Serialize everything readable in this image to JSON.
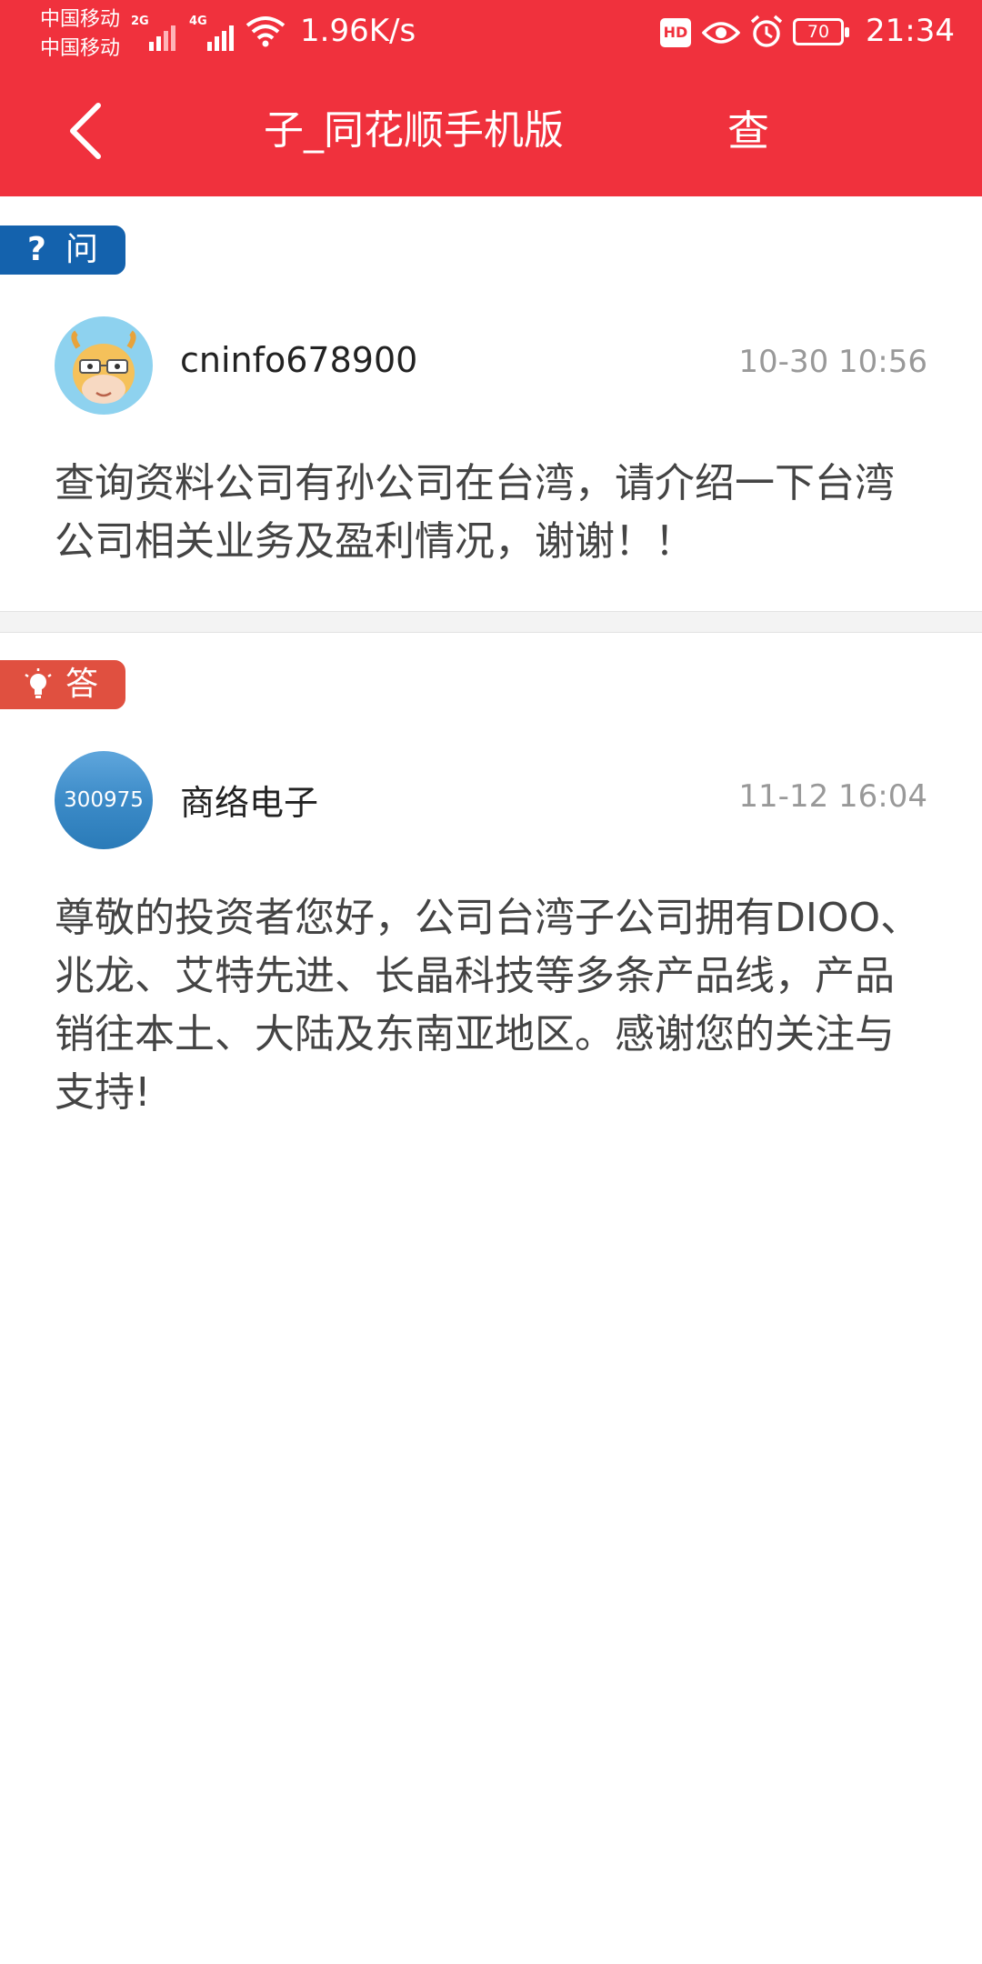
{
  "status_bar": {
    "carrier_1": "中国移动",
    "carrier_2": "中国移动",
    "signal_1_tag": "2G",
    "signal_2_tag": "4G",
    "net_speed": "1.96K/s",
    "hd_badge": "HD",
    "battery": "70",
    "time": "21:34"
  },
  "nav": {
    "title": "子_同花顺手机版",
    "action_label": "查"
  },
  "question": {
    "badge_glyph": "?",
    "badge_label": "问",
    "user": "cninfo678900",
    "time": "10-30 10:56",
    "text": "查询资料公司有孙公司在台湾，请介绍一下台湾公司相关业务及盈利情况，谢谢！！"
  },
  "answer": {
    "badge_label": "答",
    "avatar_code": "300975",
    "user": "商络电子",
    "time": "11-12 16:04",
    "text": "尊敬的投资者您好，公司台湾子公司拥有DIOO、兆龙、艾特先进、长晶科技等多条产品线，产品销往本土、大陆及东南亚地区。感谢您的关注与支持!"
  },
  "colors": {
    "header": "#f0313d",
    "question_badge": "#1462ad",
    "answer_badge": "#e05040"
  }
}
